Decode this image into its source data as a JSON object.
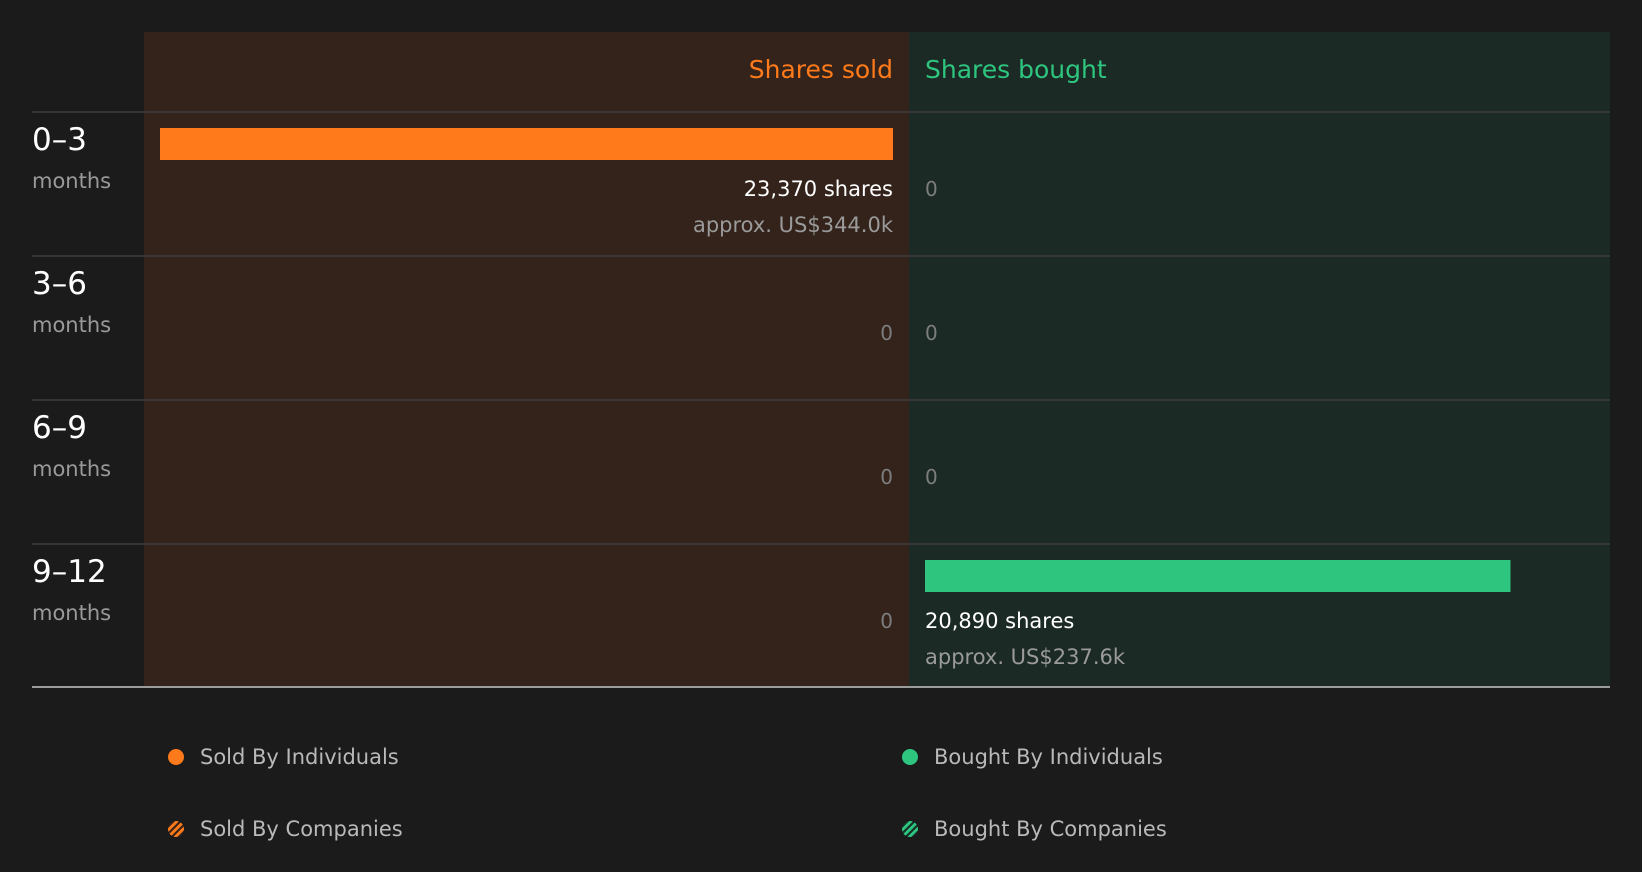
{
  "colors": {
    "page_bg": "#1b1b1b",
    "sold_bg": "#33231b",
    "bought_bg": "#1b2a24",
    "sold": "#ff7a1a",
    "bought": "#2ec57f",
    "text_primary": "#ffffff",
    "text_secondary": "#9a9a9a",
    "zero_text": "#7d7d7d",
    "divider": "#3e3e3e",
    "axis": "#9c9c9c"
  },
  "chart_data": {
    "type": "bar",
    "layout": "diverging-horizontal",
    "headers": {
      "sold": "Shares sold",
      "bought": "Shares bought"
    },
    "rows": [
      {
        "range": "0–3",
        "unit": "months",
        "sold": 23370,
        "sold_label": "23,370 shares",
        "sold_value": "approx. US$344.0k",
        "bought": 0,
        "bought_label": "0",
        "bought_value": ""
      },
      {
        "range": "3–6",
        "unit": "months",
        "sold": 0,
        "sold_label": "0",
        "sold_value": "",
        "bought": 0,
        "bought_label": "0",
        "bought_value": ""
      },
      {
        "range": "6–9",
        "unit": "months",
        "sold": 0,
        "sold_label": "0",
        "sold_value": "",
        "bought": 0,
        "bought_label": "0",
        "bought_value": ""
      },
      {
        "range": "9–12",
        "unit": "months",
        "sold": 0,
        "sold_label": "0",
        "sold_value": "",
        "bought": 20890,
        "bought_label": "20,890 shares",
        "bought_value": "approx. US$237.6k"
      }
    ],
    "legend": [
      {
        "label": "Sold By Individuals",
        "color": "#ff7a1a",
        "style": "solid"
      },
      {
        "label": "Bought By Individuals",
        "color": "#2ec57f",
        "style": "solid"
      },
      {
        "label": "Sold By Companies",
        "color": "#ff7a1a",
        "style": "hatched"
      },
      {
        "label": "Bought By Companies",
        "color": "#2ec57f",
        "style": "hatched"
      }
    ]
  }
}
